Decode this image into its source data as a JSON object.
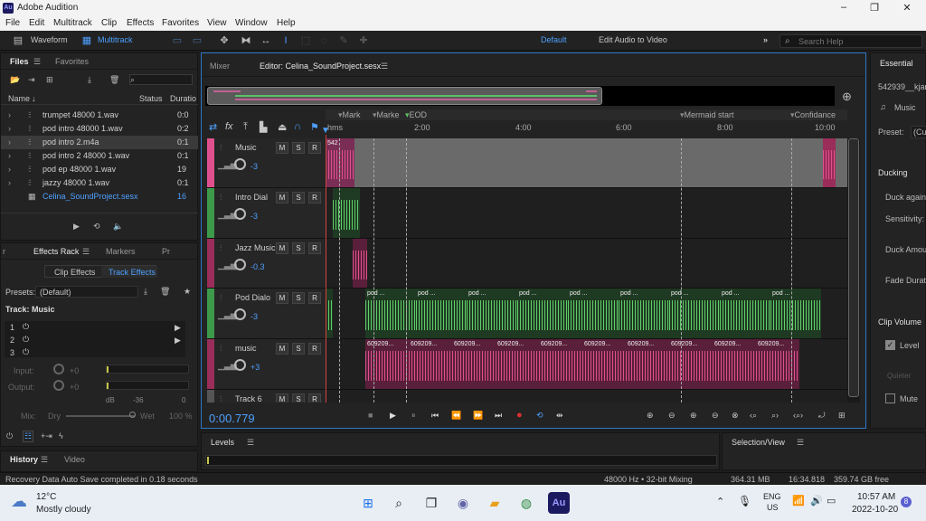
{
  "window": {
    "app_icon": "Au",
    "title": "Adobe Audition",
    "minimize": "–",
    "maximize": "❐",
    "close": "✕"
  },
  "menu": [
    "File",
    "Edit",
    "Multitrack",
    "Clip",
    "Effects",
    "Favorites",
    "View",
    "Window",
    "Help"
  ],
  "toolbar": {
    "waveform": "Waveform",
    "multitrack": "Multitrack",
    "workspace_default": "Default",
    "workspace_edit": "Edit Audio to Video",
    "more": "»",
    "search_placeholder": "Search Help"
  },
  "files_panel": {
    "tab_files": "Files",
    "tab_favorites": "Favorites",
    "col_name": "Name",
    "col_status": "Status",
    "col_duration": "Duratio",
    "items": [
      {
        "name": "trumpet 48000 1.wav",
        "dur": "0:0"
      },
      {
        "name": "pod intro 48000 1.wav",
        "dur": "0:2"
      },
      {
        "name": "pod intro 2.m4a",
        "dur": "0:1"
      },
      {
        "name": "pod intro 2 48000 1.wav",
        "dur": "0:1"
      },
      {
        "name": "pod ep 48000 1.wav",
        "dur": "19"
      },
      {
        "name": "jazzy 48000 1.wav",
        "dur": "0:1"
      },
      {
        "name": "Celina_SoundProject.sesx",
        "dur": "16"
      }
    ]
  },
  "effects_panel": {
    "tab_r": "r",
    "tab_effects_rack": "Effects Rack",
    "tab_markers": "Markers",
    "tab_pr": "Pr",
    "clip_effects": "Clip Effects",
    "track_effects": "Track Effects",
    "presets_label": "Presets:",
    "presets_value": "(Default)",
    "track_label": "Track: Music",
    "slots": [
      "1",
      "2",
      "3"
    ],
    "input": "Input:",
    "output": "Output:",
    "input_val": "+0",
    "output_val": "+0",
    "db": "dB",
    "db36": "-36",
    "db0": "0",
    "mix": "Mix:",
    "dry": "Dry",
    "wet": "Wet",
    "wet_pct": "100 %"
  },
  "history_panel": {
    "tab_history": "History",
    "tab_video": "Video"
  },
  "editor": {
    "tab_mixer": "Mixer",
    "tab_editor": "Editor: Celina_SoundProject.sesx",
    "time": "0:00.779",
    "ruler": {
      "hms": "hms",
      "t2": "2:00",
      "t4": "4:00",
      "t6": "6:00",
      "t8": "8:00",
      "t10": "10:00"
    },
    "markers": [
      "Mark",
      "Marke",
      "EOD",
      "Mermaid start",
      "Confidance"
    ],
    "tracks": [
      {
        "name": "Music",
        "vol": "-3",
        "color": "#e0508e"
      },
      {
        "name": "Intro Dial",
        "vol": "-3",
        "color": "#3c9a4a"
      },
      {
        "name": "Jazz Music",
        "vol": "-0.3",
        "color": "#9a2d5a"
      },
      {
        "name": "Pod Dialo",
        "vol": "-3",
        "color": "#3c9a4a"
      },
      {
        "name": "music",
        "vol": "+3",
        "color": "#9a2d5a"
      },
      {
        "name": "Track 6",
        "vol": "",
        "color": "#555555"
      }
    ],
    "clip_labels": {
      "music_start": "542",
      "pod": "pod ...",
      "music_c": "609209..."
    },
    "msr": {
      "m": "M",
      "s": "S",
      "r": "R"
    }
  },
  "levels_panel": {
    "title": "Levels"
  },
  "selection_panel": {
    "title": "Selection/View"
  },
  "right_panel": {
    "tab": "Essential",
    "file": "542939__kjar",
    "music": "Music",
    "preset_label": "Preset:",
    "preset_value": "(Cus",
    "ducking": "Ducking",
    "duck_again": "Duck again",
    "sensitivity": "Sensitivity:",
    "duck_amount": "Duck Amou",
    "fade_duration": "Fade Durat",
    "clip_volume": "Clip Volume",
    "level": "Level",
    "quieter": "Quieter",
    "mute": "Mute"
  },
  "status": {
    "recovery": "Recovery Data Auto Save completed in 0.18 seconds",
    "format": "48000 Hz • 32-bit Mixing",
    "mem": "364.31 MB",
    "dur": "16:34.818",
    "free": "359.74 GB free"
  },
  "taskbar": {
    "temp": "12°C",
    "weather": "Mostly cloudy",
    "lang1": "ENG",
    "lang2": "US",
    "time": "10:57 AM",
    "date": "2022-10-20",
    "badge": "8",
    "au": "Au"
  }
}
